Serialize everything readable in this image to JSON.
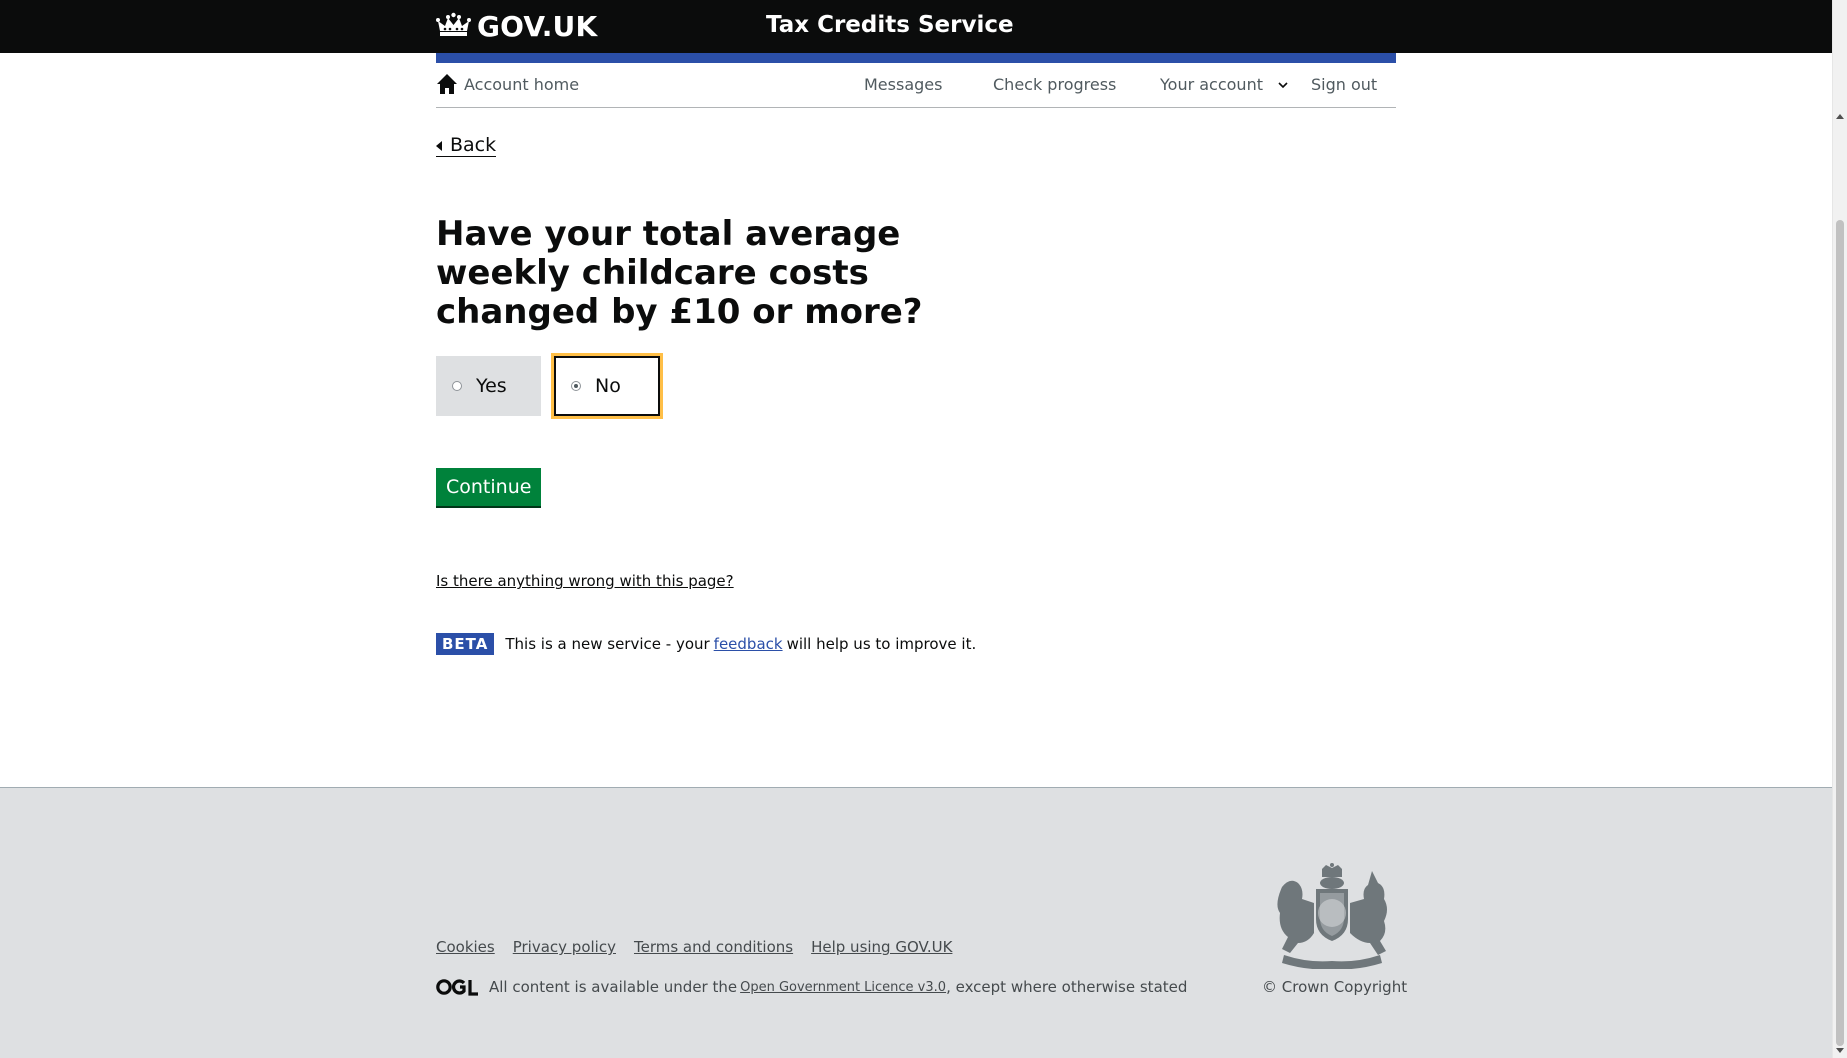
{
  "header": {
    "logo_text": "GOV.UK",
    "service_name": "Tax Credits Service",
    "logo_icon": "crown-icon"
  },
  "account_nav": {
    "home_label": "Account home",
    "home_icon": "home-icon",
    "messages_label": "Messages",
    "check_progress_label": "Check progress",
    "your_account_label": "Your account",
    "your_account_icon": "chevron-down-icon",
    "sign_out_label": "Sign out"
  },
  "back": {
    "label": "Back"
  },
  "question": {
    "heading": "Have your total average weekly childcare costs changed by £10 or more?",
    "options": [
      {
        "label": "Yes",
        "selected": false
      },
      {
        "label": "No",
        "selected": true
      }
    ]
  },
  "continue_label": "Continue",
  "problem_link": "Is there anything wrong with this page?",
  "beta": {
    "tag": "BETA",
    "text_before": "This is a new service  - your",
    "feedback_link": "feedback",
    "text_after": "will help us to improve it."
  },
  "footer": {
    "links": [
      "Cookies",
      "Privacy policy",
      "Terms and conditions",
      "Help using GOV.UK"
    ],
    "licence_before": "All content is available under the",
    "licence_link": "Open Government Licence v3.0",
    "licence_after": ", except where otherwise stated",
    "copyright": "© Crown Copyright",
    "ogl_icon": "ogl-logo-icon",
    "crest_icon": "royal-coat-of-arms-icon"
  },
  "colors": {
    "header_bg": "#0b0c0c",
    "accent_blue": "#2b4fa8",
    "continue_green": "#00823b",
    "focus_yellow": "#ffbf47",
    "footer_bg": "#dee0e2"
  }
}
